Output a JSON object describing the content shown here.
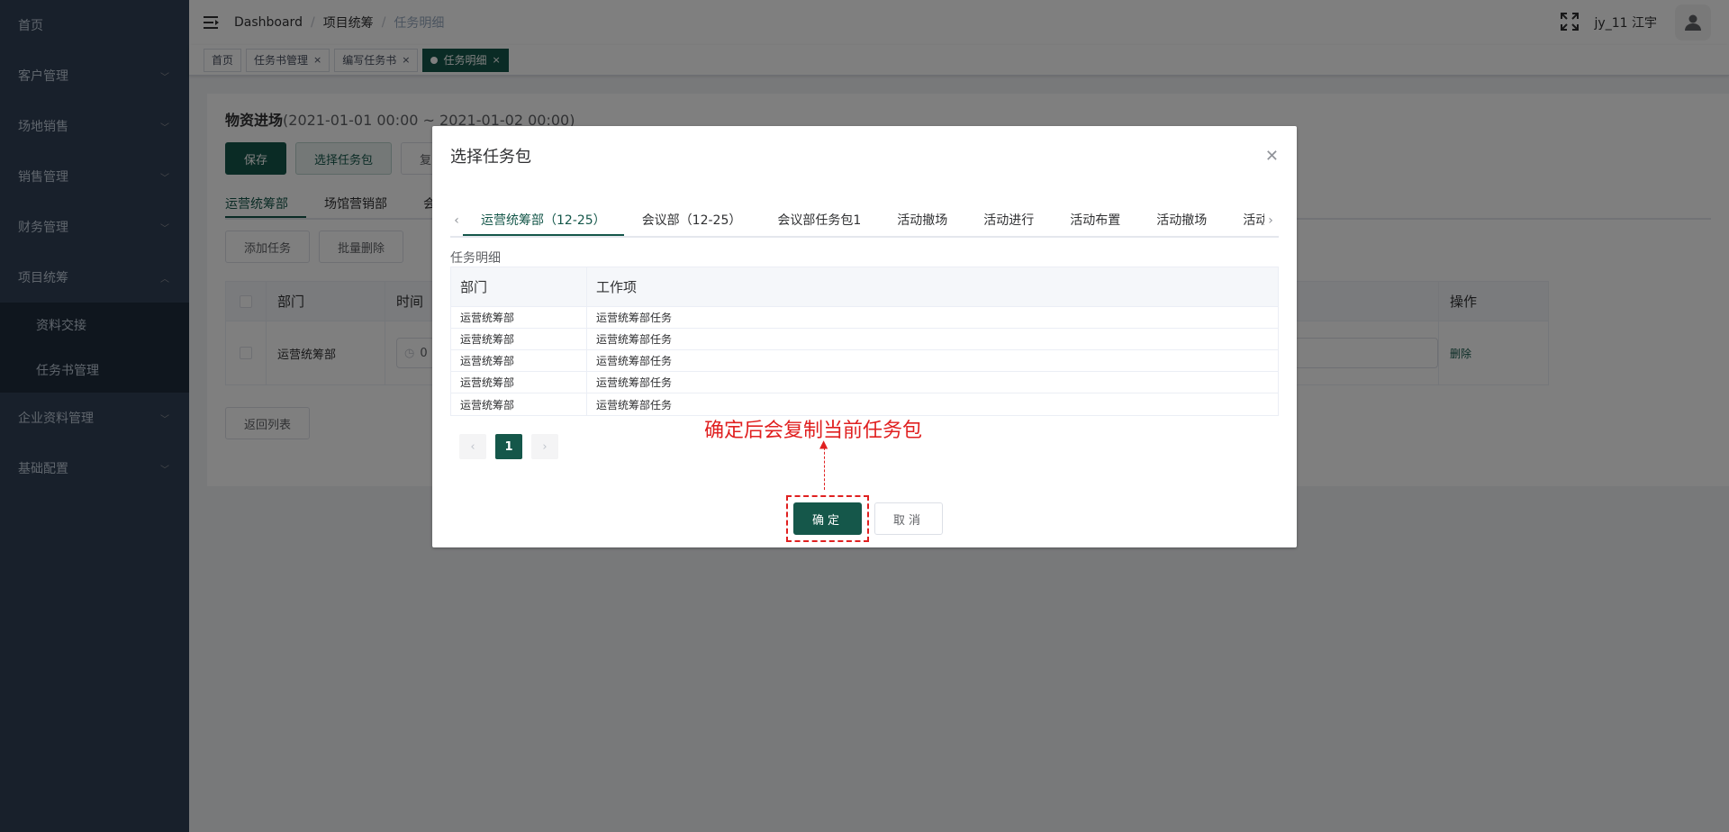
{
  "sidebar": {
    "items": [
      {
        "label": "首页",
        "has_arrow": false
      },
      {
        "label": "客户管理",
        "has_arrow": true
      },
      {
        "label": "场地销售",
        "has_arrow": true
      },
      {
        "label": "销售管理",
        "has_arrow": true
      },
      {
        "label": "财务管理",
        "has_arrow": true
      },
      {
        "label": "项目统筹",
        "has_arrow": true,
        "expanded": true
      }
    ],
    "sub_items": [
      {
        "label": "资料交接"
      },
      {
        "label": "任务书管理"
      }
    ],
    "items_after": [
      {
        "label": "企业资料管理"
      },
      {
        "label": "基础配置"
      }
    ]
  },
  "navbar": {
    "breadcrumb": [
      "Dashboard",
      "项目统筹",
      "任务明细"
    ],
    "username": "jy_11 江宇"
  },
  "tags": [
    {
      "label": "首页",
      "closable": false,
      "active": false
    },
    {
      "label": "任务书管理",
      "closable": true,
      "active": false
    },
    {
      "label": "编写任务书",
      "closable": true,
      "active": false
    },
    {
      "label": "任务明细",
      "closable": true,
      "active": true
    }
  ],
  "main": {
    "title": "物资进场",
    "range": "(2021-01-01 00:00 ~ 2021-01-02 00:00)",
    "buttons": {
      "save": "保存",
      "select_package": "选择任务包",
      "third": "复"
    },
    "tabs": [
      "运营统筹部",
      "场馆营销部",
      "会"
    ],
    "actions": {
      "add": "添加任务",
      "batch_delete": "批量删除"
    },
    "table": {
      "headers": {
        "dept": "部门",
        "time": "时间",
        "op": "操作"
      },
      "rows": [
        {
          "dept": "运营统筹部",
          "time": "0",
          "op": "删除"
        }
      ]
    },
    "back": "返回列表"
  },
  "dialog": {
    "title": "选择任务包",
    "tabs": [
      "运营统筹部（12-25）",
      "会议部（12-25）",
      "会议部任务包1",
      "活动撤场",
      "活动进行",
      "活动布置",
      "活动撤场",
      "活动进行"
    ],
    "detail_label": "任务明细",
    "table": {
      "headers": {
        "dept": "部门",
        "work": "工作项"
      },
      "rows": [
        {
          "dept": "运营统筹部",
          "work": "运营统筹部任务"
        },
        {
          "dept": "运营统筹部",
          "work": "运营统筹部任务"
        },
        {
          "dept": "运营统筹部",
          "work": "运营统筹部任务"
        },
        {
          "dept": "运营统筹部",
          "work": "运营统筹部任务"
        },
        {
          "dept": "运营统筹部",
          "work": "运营统筹部任务"
        }
      ]
    },
    "pager": {
      "prev": "‹",
      "current": "1",
      "next": "›"
    },
    "annotation": "确定后会复制当前任务包",
    "confirm": "确定",
    "cancel": "取消"
  },
  "colors": {
    "sidebar": "#304156",
    "primary": "#15574a",
    "annotation": "#e02020"
  }
}
